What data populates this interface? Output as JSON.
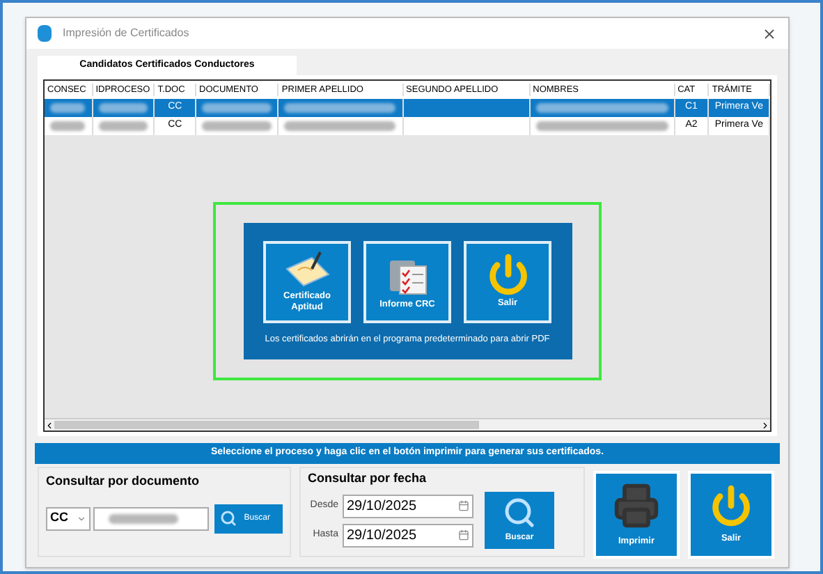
{
  "window": {
    "title": "Impresión de Certificados"
  },
  "tabs": [
    {
      "label": "Candidatos Certificados Conductores",
      "selected": true
    }
  ],
  "table": {
    "columns": [
      "CONSEC",
      "IDPROCESO",
      "T.DOC",
      "DOCUMENTO",
      "PRIMER APELLIDO",
      "SEGUNDO APELLIDO",
      "NOMBRES",
      "CAT",
      "TRÁMITE"
    ],
    "rows": [
      {
        "selected": true,
        "t_doc": "CC",
        "cat": "C1",
        "tramite": "Primera Ve"
      },
      {
        "selected": false,
        "t_doc": "CC",
        "cat": "A2",
        "tramite": "Primera Ve"
      }
    ]
  },
  "dialog": {
    "buttons": [
      {
        "kind": "certificate",
        "label": "Certificado Aptitud"
      },
      {
        "kind": "report",
        "label": "Informe CRC"
      },
      {
        "kind": "exit",
        "label": "Salir"
      }
    ],
    "note": "Los certificados abrirán en el programa predeterminado para abrir PDF"
  },
  "banner": "Seleccione el proceso y haga clic en el botón imprimir para generar sus certificados.",
  "search_by_document": {
    "title": "Consultar por documento",
    "doc_type": "CC",
    "button": "Buscar"
  },
  "search_by_date": {
    "title": "Consultar por fecha",
    "from_label": "Desde",
    "from": "29/10/2025",
    "to_label": "Hasta",
    "to": "29/10/2025",
    "button": "Buscar"
  },
  "actions": [
    {
      "kind": "print",
      "label": "Imprimir"
    },
    {
      "kind": "exit",
      "label": "Salir"
    }
  ]
}
